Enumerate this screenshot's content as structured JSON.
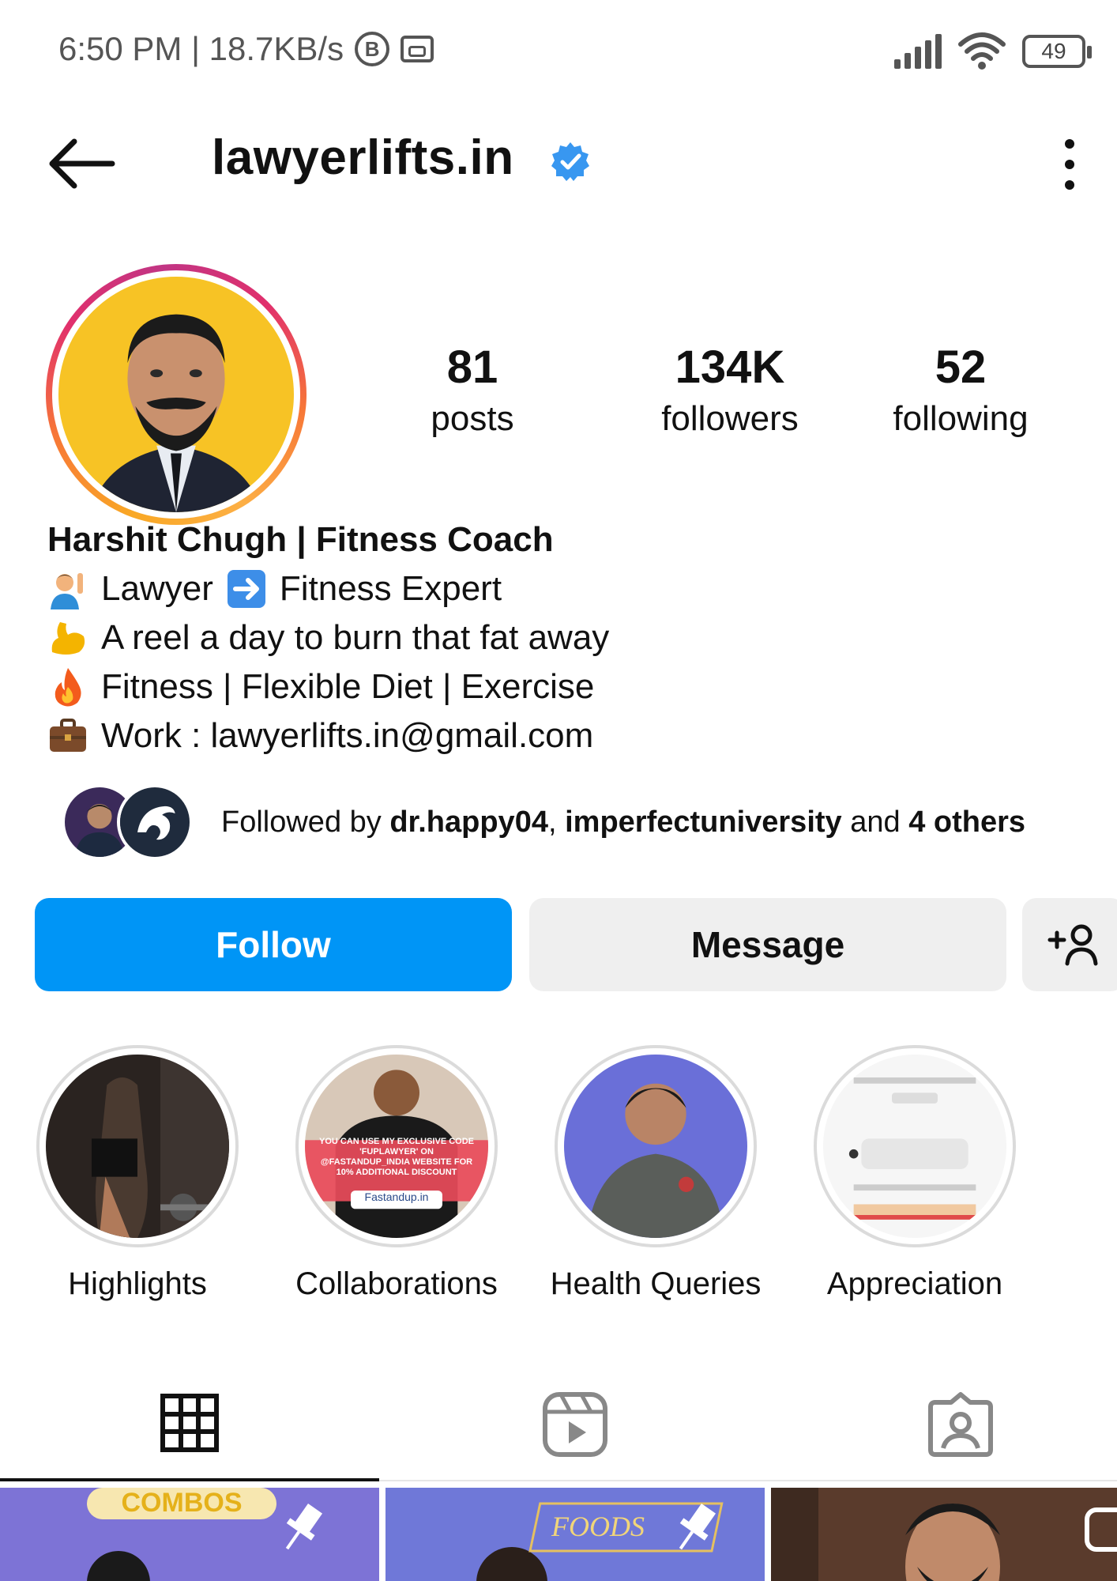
{
  "status_bar": {
    "time_speed": "6:50 PM | 18.7KB/s",
    "b_icon_label": "B",
    "battery": "49",
    "icons": [
      "signal-icon",
      "wifi-icon",
      "battery-icon"
    ]
  },
  "header": {
    "username": "lawyerlifts.in",
    "verified": true
  },
  "profile": {
    "stats": {
      "posts_count": "81",
      "posts_label": "posts",
      "followers_count": "134K",
      "followers_label": "followers",
      "following_count": "52",
      "following_label": "following"
    },
    "bio": {
      "name": "Harshit Chugh | Fitness Coach",
      "line1_a": "Lawyer",
      "line1_b": "Fitness Expert",
      "line2": "A reel a day to burn that fat away",
      "line3": "Fitness | Flexible Diet | Exercise",
      "line4": "Work : lawyerlifts.in@gmail.com"
    },
    "followed_by": {
      "prefix": "Followed by ",
      "user1": "dr.happy04",
      "sep": ", ",
      "user2": "imperfectuniversity",
      "and": " and ",
      "others": "4 others"
    }
  },
  "actions": {
    "follow_label": "Follow",
    "message_label": "Message"
  },
  "highlights": [
    {
      "label": "Highlights"
    },
    {
      "label": "Collaborations"
    },
    {
      "label": "Health Queries"
    },
    {
      "label": "Appreciation"
    }
  ],
  "highlight_text": {
    "collab_promo": "YOU CAN USE MY EXCLUSIVE CODE 'FUPLAWYER' ON @FASTANDUP_INDIA WEBSITE FOR 10% ADDITIONAL DISCOUNT",
    "collab_brand": "Fastandup.in"
  },
  "grid_text": {
    "post1": "COMBOS",
    "post2": "FOODS"
  },
  "colors": {
    "accent": "#0095f6",
    "verified": "#0095f6",
    "button_gray": "#efefef"
  }
}
